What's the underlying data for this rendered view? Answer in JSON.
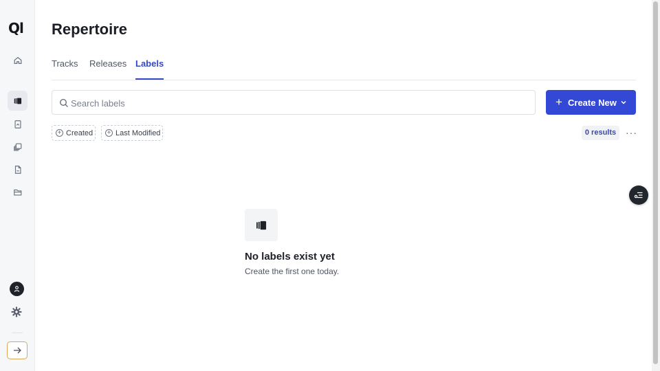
{
  "app": {
    "logo_text": "Ql"
  },
  "sidebar": {
    "items": [
      {
        "icon": "home-icon"
      },
      {
        "icon": "labels-icon",
        "active": true
      },
      {
        "icon": "document-icon"
      },
      {
        "icon": "layers-icon"
      },
      {
        "icon": "file-icon"
      },
      {
        "icon": "folder-icon"
      }
    ],
    "bottom": {
      "avatar": "user-avatar",
      "settings": "gear-icon",
      "expand": "arrow-right-icon"
    }
  },
  "page": {
    "title": "Repertoire"
  },
  "tabs": [
    {
      "label": "Tracks",
      "active": false
    },
    {
      "label": "Releases",
      "active": false
    },
    {
      "label": "Labels",
      "active": true
    }
  ],
  "search": {
    "placeholder": "Search labels",
    "value": ""
  },
  "create_button": {
    "label": "Create New"
  },
  "filters": [
    {
      "label": "Created"
    },
    {
      "label": "Last Modified"
    }
  ],
  "results": {
    "label": "0 results"
  },
  "more_menu": {
    "label": "···"
  },
  "empty_state": {
    "title": "No labels exist yet",
    "subtitle": "Create the first one today."
  },
  "colors": {
    "accent": "#3349d6",
    "tab_active": "#3347c9",
    "sidebar_bg": "#f6f7f9",
    "expand_border": "#d9a556"
  }
}
